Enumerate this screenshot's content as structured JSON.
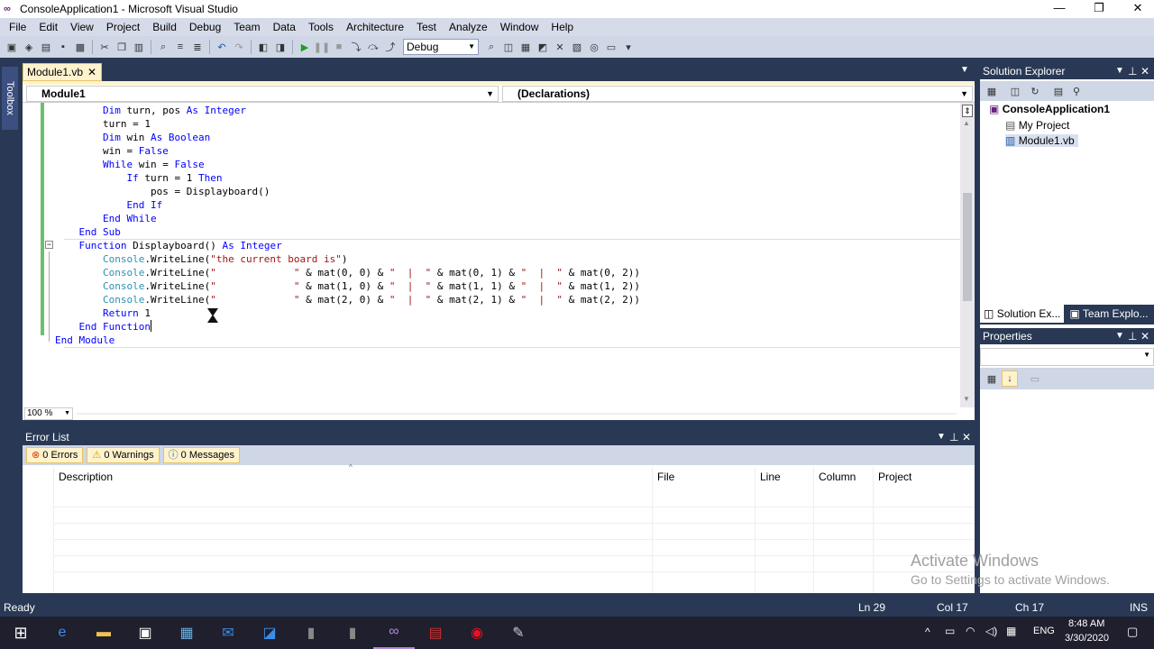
{
  "window": {
    "title": "ConsoleApplication1 - Microsoft Visual Studio",
    "logo": "∞"
  },
  "menu": [
    "File",
    "Edit",
    "View",
    "Project",
    "Build",
    "Debug",
    "Team",
    "Data",
    "Tools",
    "Architecture",
    "Test",
    "Analyze",
    "Window",
    "Help"
  ],
  "toolbar": {
    "config": "Debug"
  },
  "toolbox": {
    "label": "Toolbox"
  },
  "editor": {
    "tab": "Module1.vb",
    "nav_left": "Module1",
    "nav_right": "(Declarations)",
    "zoom": "100 %",
    "lines": [
      [
        {
          "t": "        ",
          "c": ""
        },
        {
          "t": "Dim",
          "c": "kw"
        },
        {
          "t": " turn, pos ",
          "c": ""
        },
        {
          "t": "As",
          "c": "kw"
        },
        {
          "t": " ",
          "c": ""
        },
        {
          "t": "Integer",
          "c": "kw"
        }
      ],
      [
        {
          "t": "        turn = 1",
          "c": ""
        }
      ],
      [
        {
          "t": "        ",
          "c": ""
        },
        {
          "t": "Dim",
          "c": "kw"
        },
        {
          "t": " win ",
          "c": ""
        },
        {
          "t": "As",
          "c": "kw"
        },
        {
          "t": " ",
          "c": ""
        },
        {
          "t": "Boolean",
          "c": "kw"
        }
      ],
      [
        {
          "t": "        win = ",
          "c": ""
        },
        {
          "t": "False",
          "c": "kw"
        }
      ],
      [
        {
          "t": "        ",
          "c": ""
        },
        {
          "t": "While",
          "c": "kw"
        },
        {
          "t": " win = ",
          "c": ""
        },
        {
          "t": "False",
          "c": "kw"
        }
      ],
      [
        {
          "t": "            ",
          "c": ""
        },
        {
          "t": "If",
          "c": "kw"
        },
        {
          "t": " turn = 1 ",
          "c": ""
        },
        {
          "t": "Then",
          "c": "kw"
        }
      ],
      [
        {
          "t": "                pos = Displayboard()",
          "c": ""
        }
      ],
      [
        {
          "t": "            ",
          "c": ""
        },
        {
          "t": "End If",
          "c": "kw"
        }
      ],
      [
        {
          "t": "        ",
          "c": ""
        },
        {
          "t": "End While",
          "c": "kw"
        }
      ],
      [
        {
          "t": "    ",
          "c": ""
        },
        {
          "t": "End Sub",
          "c": "kw"
        }
      ],
      [
        {
          "t": "    ",
          "c": ""
        },
        {
          "t": "Function",
          "c": "kw"
        },
        {
          "t": " Displayboard() ",
          "c": ""
        },
        {
          "t": "As",
          "c": "kw"
        },
        {
          "t": " ",
          "c": ""
        },
        {
          "t": "Integer",
          "c": "kw"
        }
      ],
      [
        {
          "t": "        ",
          "c": ""
        },
        {
          "t": "Console",
          "c": "id"
        },
        {
          "t": ".WriteLine(",
          "c": ""
        },
        {
          "t": "\"the current board is\"",
          "c": "st"
        },
        {
          "t": ")",
          "c": ""
        }
      ],
      [
        {
          "t": "        ",
          "c": ""
        },
        {
          "t": "Console",
          "c": "id"
        },
        {
          "t": ".WriteLine(",
          "c": ""
        },
        {
          "t": "\"             \"",
          "c": "st"
        },
        {
          "t": " & mat(0, 0) & ",
          "c": ""
        },
        {
          "t": "\"  |  \"",
          "c": "st"
        },
        {
          "t": " & mat(0, 1) & ",
          "c": ""
        },
        {
          "t": "\"  |  \"",
          "c": "st"
        },
        {
          "t": " & mat(0, 2))",
          "c": ""
        }
      ],
      [
        {
          "t": "        ",
          "c": ""
        },
        {
          "t": "Console",
          "c": "id"
        },
        {
          "t": ".WriteLine(",
          "c": ""
        },
        {
          "t": "\"             \"",
          "c": "st"
        },
        {
          "t": " & mat(1, 0) & ",
          "c": ""
        },
        {
          "t": "\"  |  \"",
          "c": "st"
        },
        {
          "t": " & mat(1, 1) & ",
          "c": ""
        },
        {
          "t": "\"  |  \"",
          "c": "st"
        },
        {
          "t": " & mat(1, 2))",
          "c": ""
        }
      ],
      [
        {
          "t": "        ",
          "c": ""
        },
        {
          "t": "Console",
          "c": "id"
        },
        {
          "t": ".WriteLine(",
          "c": ""
        },
        {
          "t": "\"             \"",
          "c": "st"
        },
        {
          "t": " & mat(2, 0) & ",
          "c": ""
        },
        {
          "t": "\"  |  \"",
          "c": "st"
        },
        {
          "t": " & mat(2, 1) & ",
          "c": ""
        },
        {
          "t": "\"  |  \"",
          "c": "st"
        },
        {
          "t": " & mat(2, 2))",
          "c": ""
        }
      ],
      [
        {
          "t": "        ",
          "c": ""
        },
        {
          "t": "Return",
          "c": "kw"
        },
        {
          "t": " 1",
          "c": ""
        }
      ],
      [
        {
          "t": "    ",
          "c": ""
        },
        {
          "t": "End Function",
          "c": "kw"
        }
      ],
      [
        {
          "t": "",
          "c": ""
        },
        {
          "t": "End Module",
          "c": "kw"
        }
      ]
    ]
  },
  "errorlist": {
    "title": "Error List",
    "errors": "0 Errors",
    "warnings": "0 Warnings",
    "messages": "0 Messages",
    "columns": {
      "description": "Description",
      "file": "File",
      "line": "Line",
      "column": "Column",
      "project": "Project"
    }
  },
  "solution_explorer": {
    "title": "Solution Explorer",
    "root": "ConsoleApplication1",
    "items": [
      "My Project",
      "Module1.vb"
    ],
    "tab_solution": "Solution Ex...",
    "tab_team": "Team Explo..."
  },
  "properties": {
    "title": "Properties"
  },
  "watermark": {
    "line1": "Activate Windows",
    "line2": "Go to Settings to activate Windows."
  },
  "status": {
    "ready": "Ready",
    "ln": "Ln 29",
    "col": "Col 17",
    "ch": "Ch 17",
    "mode": "INS"
  },
  "taskbar": {
    "time": "8:48 AM",
    "date": "3/30/2020",
    "lang": "ENG"
  }
}
